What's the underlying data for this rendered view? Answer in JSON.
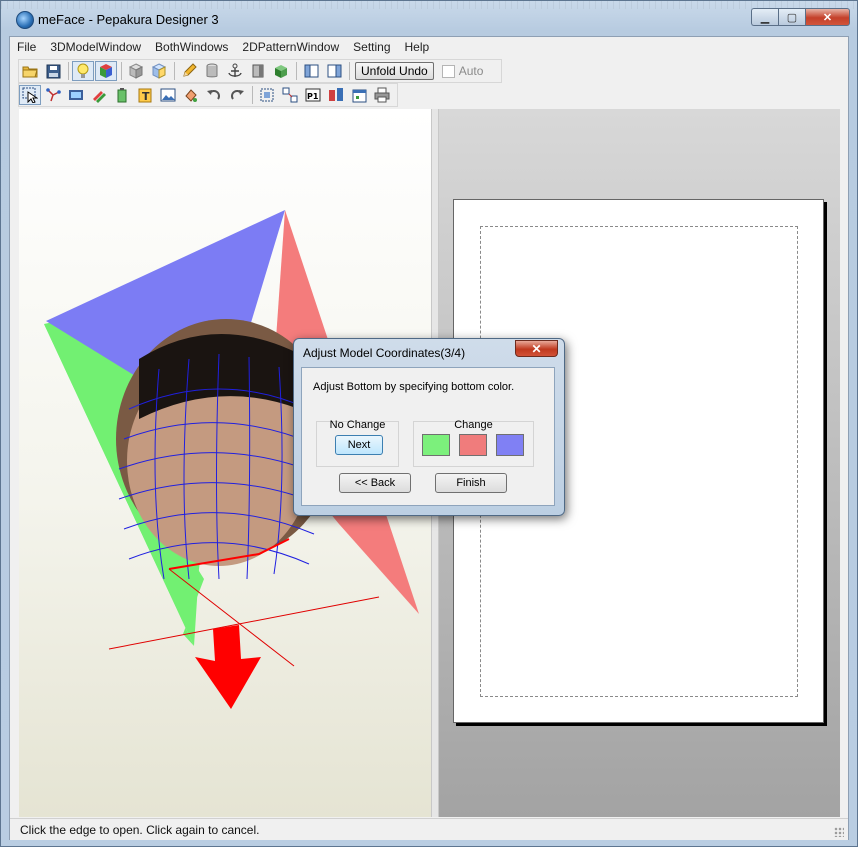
{
  "window": {
    "title": "meFace - Pepakura Designer 3"
  },
  "window_buttons": {
    "minimize": "▁",
    "maximize": "▢",
    "close": "✕"
  },
  "menu": [
    "File",
    "3DModelWindow",
    "BothWindows",
    "2DPatternWindow",
    "Setting",
    "Help"
  ],
  "toolbar1": {
    "unfold_undo_label": "Unfold Undo",
    "auto_label": "Auto"
  },
  "status": {
    "text": "Click the edge to open. Click again to cancel."
  },
  "dialog": {
    "title": "Adjust Model Coordinates(3/4)",
    "close_glyph": "✕",
    "message": "Adjust Bottom by specifying bottom color.",
    "no_change_label": "No Change",
    "next_label": "Next",
    "change_label": "Change",
    "back_label": "<< Back",
    "finish_label": "Finish",
    "colors": {
      "green": "#7cf07c",
      "red": "#f07c7c",
      "blue": "#8080f4"
    }
  }
}
